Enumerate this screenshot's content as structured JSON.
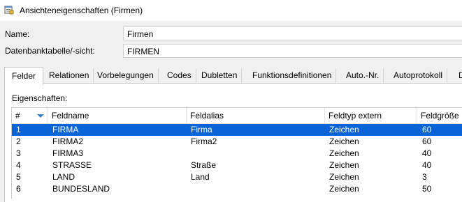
{
  "window": {
    "title": "Ansichteneigenschaften (Firmen)"
  },
  "form": {
    "name_label": "Name:",
    "name_value": "Firmen",
    "table_label": "Datenbanktabelle/-sicht:",
    "table_value": "FIRMEN"
  },
  "tabs": [
    {
      "label": "Felder"
    },
    {
      "label": "Relationen"
    },
    {
      "label": "Vorbelegungen"
    },
    {
      "label": "Codes"
    },
    {
      "label": "Dubletten"
    },
    {
      "label": "Funktionsdefinitionen"
    },
    {
      "label": "Auto.-Nr."
    },
    {
      "label": "Autoprotokoll"
    },
    {
      "label": "D"
    }
  ],
  "section": {
    "label": "Eigenschaften:"
  },
  "grid": {
    "columns": [
      "#",
      "Feldname",
      "Feldalias",
      "Feldtyp extern",
      "Feldgröße"
    ],
    "rows": [
      [
        "1",
        "FIRMA",
        "Firma",
        "Zeichen",
        "60"
      ],
      [
        "2",
        "FIRMA2",
        "Firma2",
        "Zeichen",
        "60"
      ],
      [
        "3",
        "FIRMA3",
        "",
        "Zeichen",
        "40"
      ],
      [
        "4",
        "STRASSE",
        "Straße",
        "Zeichen",
        "40"
      ],
      [
        "5",
        "LAND",
        "Land",
        "Zeichen",
        "3"
      ],
      [
        "6",
        "BUNDESLAND",
        "",
        "Zeichen",
        "50"
      ]
    ]
  },
  "colors": {
    "selection": "#0a64d8",
    "sort_arrow": "#3b7fd4"
  }
}
